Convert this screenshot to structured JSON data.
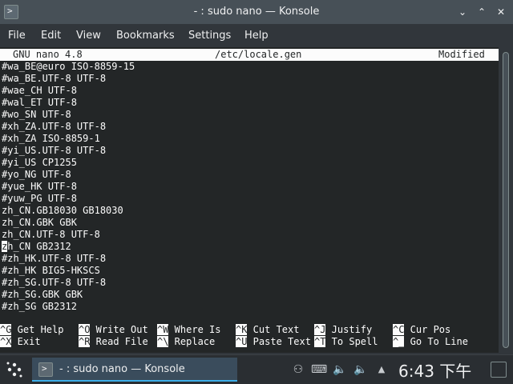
{
  "window": {
    "title": "- : sudo nano — Konsole",
    "app_icon_glyph": ">",
    "min_glyph": "⌄",
    "max_glyph": "⌃",
    "close_glyph": "✕"
  },
  "menu": {
    "file": "File",
    "edit": "Edit",
    "view": "View",
    "bookmarks": "Bookmarks",
    "settings": "Settings",
    "help": "Help"
  },
  "nano": {
    "version": "GNU nano 4.8",
    "filename": "/etc/locale.gen",
    "status": "Modified",
    "lines": [
      "#wa_BE@euro ISO-8859-15",
      "#wa_BE.UTF-8 UTF-8",
      "#wae_CH UTF-8",
      "#wal_ET UTF-8",
      "#wo_SN UTF-8",
      "#xh_ZA.UTF-8 UTF-8",
      "#xh_ZA ISO-8859-1",
      "#yi_US.UTF-8 UTF-8",
      "#yi_US CP1255",
      "#yo_NG UTF-8",
      "#yue_HK UTF-8",
      "#yuw_PG UTF-8",
      "zh_CN.GB18030 GB18030",
      "zh_CN.GBK GBK",
      "zh_CN.UTF-8 UTF-8",
      "zh_CN GB2312",
      "#zh_HK.UTF-8 UTF-8",
      "#zh_HK BIG5-HKSCS",
      "#zh_SG.UTF-8 UTF-8",
      "#zh_SG.GBK GBK",
      "#zh_SG GB2312"
    ],
    "cursor_line": 15,
    "shortcuts_row1": [
      {
        "key": "^G",
        "label": "Get Help"
      },
      {
        "key": "^O",
        "label": "Write Out"
      },
      {
        "key": "^W",
        "label": "Where Is"
      },
      {
        "key": "^K",
        "label": "Cut Text"
      },
      {
        "key": "^J",
        "label": "Justify"
      },
      {
        "key": "^C",
        "label": "Cur Pos"
      }
    ],
    "shortcuts_row2": [
      {
        "key": "^X",
        "label": "Exit"
      },
      {
        "key": "^R",
        "label": "Read File"
      },
      {
        "key": "^\\",
        "label": "Replace"
      },
      {
        "key": "^U",
        "label": "Paste Text"
      },
      {
        "key": "^T",
        "label": "To Spell"
      },
      {
        "key": "^_",
        "label": "Go To Line"
      }
    ]
  },
  "taskbar": {
    "task_label": "- : sudo nano — Konsole",
    "task_icon_glyph": ">",
    "clock": "6:43 下午",
    "tray_icons": [
      "user-icon",
      "keyboard-icon",
      "volume-icon",
      "volume-icon",
      "expand-up-icon"
    ],
    "tray_glyphs": {
      "user": "⚇",
      "keyboard": "⌨",
      "volume1": "🔈",
      "volume2": "🔈",
      "up": "▲"
    }
  }
}
